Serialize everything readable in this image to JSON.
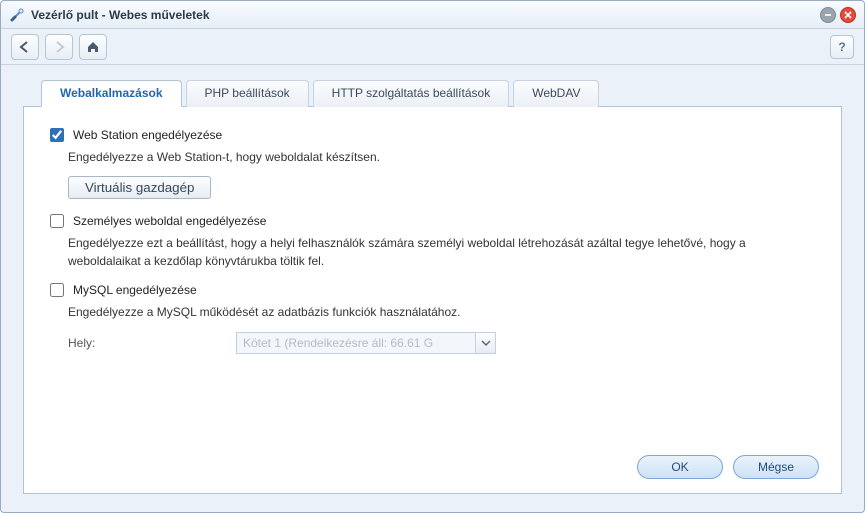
{
  "window": {
    "title": "Vezérlő pult - Webes műveletek"
  },
  "tabs": [
    {
      "label": "Webalkalmazások",
      "active": true
    },
    {
      "label": "PHP beállítások",
      "active": false
    },
    {
      "label": "HTTP szolgáltatás beállítások",
      "active": false
    },
    {
      "label": "WebDAV",
      "active": false
    }
  ],
  "webapps": {
    "web_station": {
      "checkbox_label": "Web Station engedélyezése",
      "checked": true,
      "description": "Engedélyezze a Web Station-t, hogy weboldalat készítsen.",
      "virtual_host_button": "Virtuális gazdagép"
    },
    "personal_site": {
      "checkbox_label": "Személyes weboldal engedélyezése",
      "checked": false,
      "description": "Engedélyezze ezt a beállítást, hogy a helyi felhasználók számára személyi weboldal létrehozását azáltal tegye lehetővé, hogy a weboldalaikat a kezdőlap könyvtárukba töltik fel."
    },
    "mysql": {
      "checkbox_label": "MySQL engedélyezése",
      "checked": false,
      "description": "Engedélyezze a MySQL működését az adatbázis funkciók használatához.",
      "location_label": "Hely:",
      "location_value": "Kötet 1 (Rendelkezésre áll: 66.61 G",
      "location_enabled": false
    }
  },
  "buttons": {
    "ok": "OK",
    "cancel": "Mégse"
  }
}
